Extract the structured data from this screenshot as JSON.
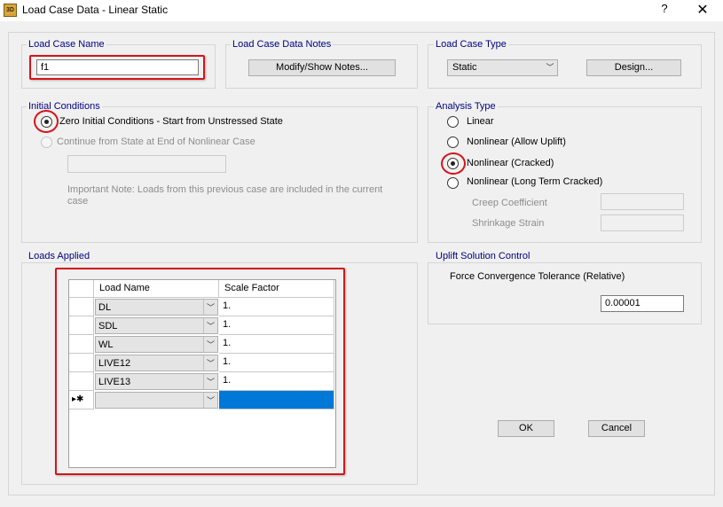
{
  "window": {
    "title": "Load Case Data - Linear Static",
    "icon_text": "3D",
    "help": "?",
    "close": "✕"
  },
  "load_case_name": {
    "label": "Load Case Name",
    "value": "f1"
  },
  "notes": {
    "label": "Load Case Data Notes",
    "button": "Modify/Show Notes..."
  },
  "load_case_type": {
    "label": "Load Case Type",
    "selected": "Static",
    "design_button": "Design..."
  },
  "initial_conditions": {
    "label": "Initial Conditions",
    "option_zero": "Zero Initial Conditions - Start from Unstressed State",
    "option_continue": "Continue from State at End of Nonlinear Case",
    "continue_value": "",
    "note_line1": "Important Note:  Loads from this previous case are included in the current",
    "note_line2": "case"
  },
  "analysis_type": {
    "label": "Analysis Type",
    "options": [
      "Linear",
      "Nonlinear (Allow Uplift)",
      "Nonlinear (Cracked)",
      "Nonlinear (Long Term Cracked)"
    ],
    "selected": "Nonlinear (Cracked)",
    "creep_label": "Creep Coefficient",
    "creep_value": "",
    "shrinkage_label": "Shrinkage Strain",
    "shrinkage_value": ""
  },
  "loads_applied": {
    "label": "Loads Applied",
    "columns": [
      "Load Name",
      "Scale Factor"
    ],
    "rows": [
      {
        "name": "DL",
        "factor": "1."
      },
      {
        "name": "SDL",
        "factor": "1."
      },
      {
        "name": "WL",
        "factor": "1."
      },
      {
        "name": "LIVE12",
        "factor": "1."
      },
      {
        "name": "LIVE13",
        "factor": "1."
      }
    ],
    "new_row_marker": "▸✱"
  },
  "uplift": {
    "label": "Uplift Solution Control",
    "tolerance_label": "Force Convergence Tolerance (Relative)",
    "tolerance_value": "0.00001"
  },
  "buttons": {
    "ok": "OK",
    "cancel": "Cancel"
  },
  "icons": {
    "dropdown": "chevron-down-icon",
    "close": "close-icon"
  },
  "colors": {
    "accent_label": "#000080",
    "highlight": "#d4141a",
    "selection": "#0078d7"
  }
}
